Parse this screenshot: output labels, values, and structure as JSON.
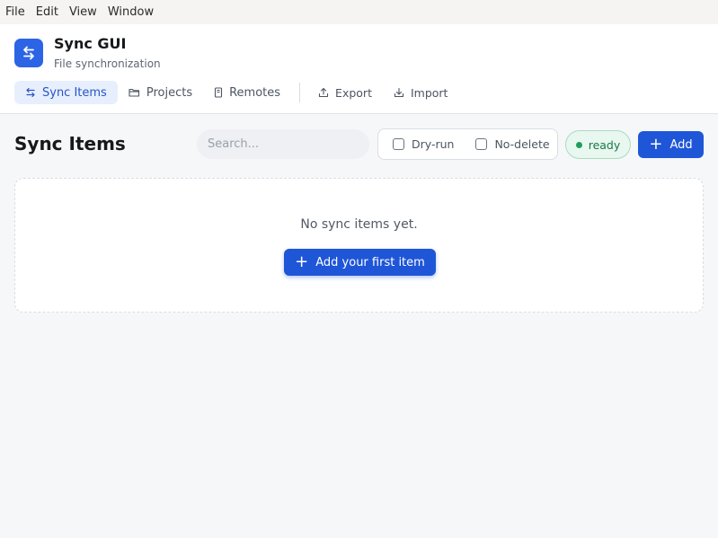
{
  "menubar": {
    "items": [
      "File",
      "Edit",
      "View",
      "Window"
    ]
  },
  "app": {
    "title": "Sync GUI",
    "subtitle": "File synchronization",
    "icon": "swap-arrows-icon",
    "accent": "#2c64e6"
  },
  "nav": {
    "tabs": [
      {
        "label": "Sync Items",
        "icon": "swap-arrows-icon",
        "active": true
      },
      {
        "label": "Projects",
        "icon": "folder-icon",
        "active": false
      },
      {
        "label": "Remotes",
        "icon": "server-icon",
        "active": false
      }
    ],
    "actions": [
      {
        "label": "Export",
        "icon": "upload-icon"
      },
      {
        "label": "Import",
        "icon": "download-icon"
      }
    ]
  },
  "main": {
    "title": "Sync Items",
    "search": {
      "placeholder": "Search...",
      "value": ""
    },
    "options": [
      {
        "label": "Dry-run",
        "checked": false
      },
      {
        "label": "No-delete",
        "checked": false
      }
    ],
    "status": {
      "label": "ready",
      "color": "#1f9d5c"
    },
    "add_button": "Add",
    "empty_state": {
      "message": "No sync items yet.",
      "button": "Add your first item"
    }
  },
  "colors": {
    "primary_button": "#1f56d8",
    "active_tab_bg": "#e7effd",
    "active_tab_text": "#2754c5"
  }
}
